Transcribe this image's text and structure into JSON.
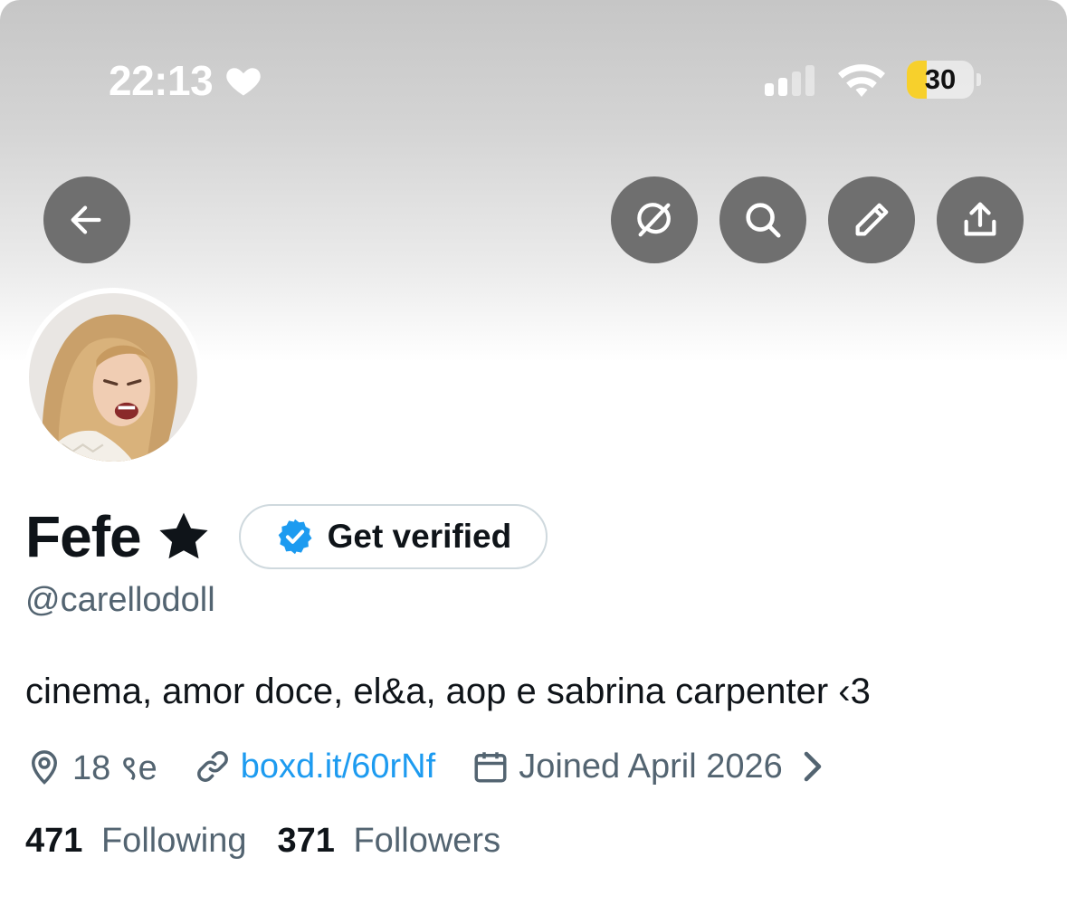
{
  "status_bar": {
    "time": "22:13",
    "battery_level": "30",
    "battery_fraction": 0.3,
    "icons": [
      "heart-icon",
      "signal-icon",
      "wifi-icon",
      "battery-icon"
    ]
  },
  "toolbar": {
    "buttons": [
      "back-arrow-icon",
      "grok-icon",
      "search-icon",
      "edit-pencil-icon",
      "share-icon"
    ]
  },
  "profile": {
    "display_name": "Fefe",
    "name_emoji": "star-icon",
    "verify_label": "Get verified",
    "handle": "@carellodoll",
    "bio": "cinema, amor doce, el&a, aop e sabrina carpenter ‹3",
    "location": "18 ९e",
    "link": "boxd.it/60rNf",
    "joined": "Joined April 2026"
  },
  "stats": {
    "following_count": "471",
    "following_label": "Following",
    "followers_count": "371",
    "followers_label": "Followers"
  },
  "colors": {
    "link": "#1d9bf0",
    "verified_badge": "#1d9bf0",
    "battery_low": "#f7d02c",
    "button_bg": "#6f6f6f"
  }
}
